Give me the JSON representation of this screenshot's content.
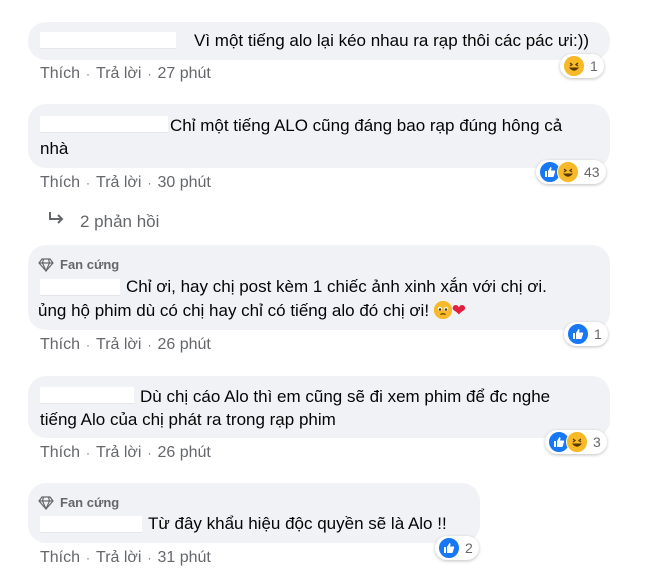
{
  "actions": {
    "like": "Thích",
    "reply": "Trả lời",
    "separator": "·"
  },
  "comments": [
    {
      "text": "Vì một tiếng alo lại kéo nhau ra rạp thôi các pác ưi:))",
      "time": "27 phút",
      "reaction_count": "1",
      "reactions": [
        "haha-icon"
      ]
    },
    {
      "text_line1": "Chỉ một tiếng ALO cũng đáng bao rạp đúng hông cả",
      "text_line2": "nhà",
      "time": "30 phút",
      "reaction_count": "43",
      "reactions": [
        "like-icon",
        "haha-icon"
      ]
    },
    {
      "badge": "Fan cứng",
      "text_line1": "Chỉ ơi, hay chị post kèm 1 chiếc ảnh xinh xắn với chị ơi.",
      "text_line2": "ủng hộ phim dù có chị hay chỉ có tiếng alo đó chị ơi!",
      "time": "26 phút",
      "reaction_count": "1",
      "reactions": [
        "like-icon"
      ]
    },
    {
      "text_line1": "Dù chị cáo Alo thì em cũng sẽ đi xem phim để đc nghe",
      "text_line2": "tiếng Alo của chị phát ra trong rạp phim",
      "time": "26 phút",
      "reaction_count": "3",
      "reactions": [
        "like-icon",
        "haha-icon"
      ]
    },
    {
      "badge": "Fan cứng",
      "text": "Từ đây khẩu hiệu độc quyền sẽ là Alo !!",
      "time": "31 phút",
      "reaction_count": "2",
      "reactions": [
        "like-icon"
      ]
    }
  ],
  "replies_link": "2 phản hồi",
  "colors": {
    "bubble": "#f0f2f5",
    "meta": "#65676b",
    "like": "#1877f2",
    "haha": "#f7b928",
    "heart": "#e41e3f"
  }
}
